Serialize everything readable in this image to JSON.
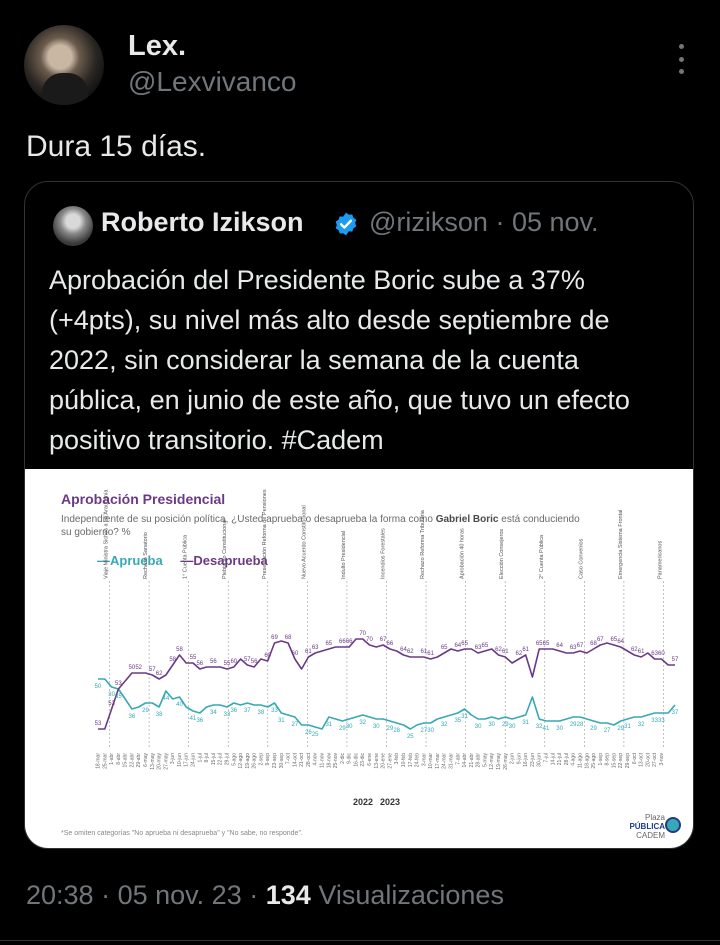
{
  "tweet": {
    "author_name": "Lex.",
    "author_handle": "@Lexvivanco",
    "text": "Dura 15 días.",
    "time": "20:38",
    "date": "05 nov. 23",
    "views_count": "134",
    "views_label": "Visualizaciones",
    "separator": "·"
  },
  "quote": {
    "author_name": "Roberto Izikson",
    "author_handle": "@rizikson",
    "date": "05 nov.",
    "text": "Aprobación del Presidente Boric sube a 37% (+4pts), su nivel más alto desde septiembre de 2022, sin considerar la semana de la cuenta pública, en junio de este año, que tuvo un efecto positivo transitorio. #Cadem"
  },
  "icons": {
    "more": "more-dots-icon",
    "verified": "verified-badge-icon",
    "verified_color": "#1d9bf0"
  },
  "chart_data": {
    "type": "line",
    "title": "Aprobación Presidencial",
    "subtitle": "Independiente de su posición política, ¿Usted aprueba o desaprueba la forma como Gabriel Boric está conduciendo su gobierno? %",
    "subtitle_emphasis": "Gabriel Boric",
    "ylim": [
      20,
      80
    ],
    "series": [
      {
        "name": "—Aprueba",
        "color": "#36a9b5",
        "values": [
          50,
          50,
          46,
          45,
          40,
          35,
          36,
          38,
          38,
          36,
          44,
          40,
          41,
          36,
          34,
          33,
          36,
          37,
          37,
          36,
          38,
          37,
          38,
          37,
          37,
          36,
          38,
          33,
          32,
          31,
          27,
          27,
          26,
          25,
          31,
          30,
          29,
          30,
          31,
          32,
          31,
          30,
          30,
          29,
          28,
          27,
          25,
          27,
          28,
          28,
          30,
          31,
          32,
          33,
          35,
          32,
          30,
          30,
          31,
          30,
          31,
          30,
          31,
          32,
          41,
          30,
          29,
          29,
          29,
          30,
          31,
          31,
          30,
          29,
          28,
          28,
          27,
          29,
          30,
          31,
          31,
          32,
          33,
          33,
          33,
          37
        ]
      },
      {
        "name": "—Desaprueba",
        "color": "#6b3a86",
        "values": [
          25,
          25,
          35,
          45,
          49,
          53,
          53,
          53,
          52,
          50,
          52,
          57,
          62,
          58,
          58,
          55,
          56,
          56,
          56,
          55,
          56,
          60,
          57,
          56,
          60,
          59,
          68,
          69,
          68,
          60,
          55,
          61,
          63,
          64,
          65,
          66,
          66,
          66,
          70,
          70,
          67,
          66,
          67,
          65,
          64,
          62,
          61,
          61,
          61,
          60,
          61,
          63,
          65,
          64,
          65,
          65,
          63,
          64,
          65,
          62,
          61,
          58,
          60,
          62,
          51,
          65,
          65,
          65,
          64,
          63,
          63,
          64,
          63,
          65,
          67,
          68,
          67,
          66,
          64,
          62,
          61,
          63,
          60,
          60,
          57,
          57
        ]
      }
    ],
    "label_values": {
      "aprueba": [
        "50",
        "30",
        "35",
        "36",
        "29",
        "38",
        "44",
        "40",
        "41",
        "36",
        "34",
        "33",
        "36",
        "37",
        "38",
        "33",
        "31",
        "27",
        "26",
        "25",
        "31",
        "29",
        "30",
        "32",
        "30",
        "29",
        "28",
        "25",
        "27",
        "30",
        "32",
        "35",
        "31",
        "30",
        "30",
        "29",
        "30",
        "31",
        "32",
        "41",
        "30",
        "29",
        "28",
        "29",
        "27",
        "29",
        "31",
        "32",
        "33",
        "33",
        "37"
      ],
      "desaprueba": [
        "53",
        "53",
        "53",
        "50",
        "52",
        "57",
        "62",
        "58",
        "58",
        "55",
        "56",
        "56",
        "55",
        "60",
        "57",
        "56",
        "60",
        "69",
        "68",
        "60",
        "61",
        "63",
        "65",
        "66",
        "66",
        "70",
        "70",
        "67",
        "66",
        "64",
        "62",
        "61",
        "61",
        "65",
        "64",
        "65",
        "63",
        "65",
        "62",
        "61",
        "62",
        "61",
        "65",
        "65",
        "64",
        "63",
        "67",
        "68",
        "67",
        "65",
        "64",
        "62",
        "61",
        "63",
        "60",
        "57"
      ]
    },
    "events": [
      "Viaje Ministra Siches a La Araucanía",
      "Rechazo Sanatorio",
      "1° Cuenta Pública",
      "Plebiscito Constitucional",
      "Presentación Reforma de Pensiones",
      "Nuevo Acuerdo Constitucional",
      "Indulto Presidencial",
      "Incendios Forestales",
      "Rechazo Reforma Tributaria",
      "Aprobación 40 horas",
      "Elección Consejeros",
      "2° Cuenta Pública",
      "Caso Convenios",
      "Emergencia Sistema Frontal",
      "Panamericanos"
    ],
    "x_ticks": [
      "18-mar",
      "25-mar",
      "1-abr",
      "8-abr",
      "15-abr",
      "22-abr",
      "29-abr",
      "6-may",
      "13-may",
      "20-may",
      "27-may",
      "3-jun",
      "10-jun",
      "17-jun",
      "24-jun",
      "1-jul",
      "8-jul",
      "15-jul",
      "22-jul",
      "29-jul",
      "5-ago",
      "12-ago",
      "19-ago",
      "26-ago",
      "2-sep",
      "9-sep",
      "23-sep",
      "30-sep",
      "7-oct",
      "14-oct",
      "21-oct",
      "28-oct",
      "4-nov",
      "11-nov",
      "18-nov",
      "25-nov",
      "2-dic",
      "9-dic",
      "16-dic",
      "23-dic",
      "6-ene",
      "13-ene",
      "20-ene",
      "27-ene",
      "3-feb",
      "10-feb",
      "17-feb",
      "24-feb",
      "3-mar",
      "10-mar",
      "17-mar",
      "24-mar",
      "31-mar",
      "7-abr",
      "14-abr",
      "21-abr",
      "28-abr",
      "5-may",
      "12-may",
      "19-may",
      "26-may",
      "2-jun",
      "9-jun",
      "16-jun",
      "23-jun",
      "30-jun",
      "7-jul",
      "14-jul",
      "21-jul",
      "28-jul",
      "4-ago",
      "11-ago",
      "18-ago",
      "25-ago",
      "1-sep",
      "8-sep",
      "15-sep",
      "22-sep",
      "29-sep",
      "6-oct",
      "13-oct",
      "20-oct",
      "27-oct",
      "3-nov"
    ],
    "year_labels": [
      "2022",
      "2023"
    ],
    "footnote": "*Se omiten categorías \"No aprueba ni desaprueba\" y \"No sabe, no responde\".",
    "logo_lines": [
      "Plaza",
      "PÚBLICA",
      "CADEM"
    ],
    "grid": false,
    "legend_position": "top-left"
  }
}
